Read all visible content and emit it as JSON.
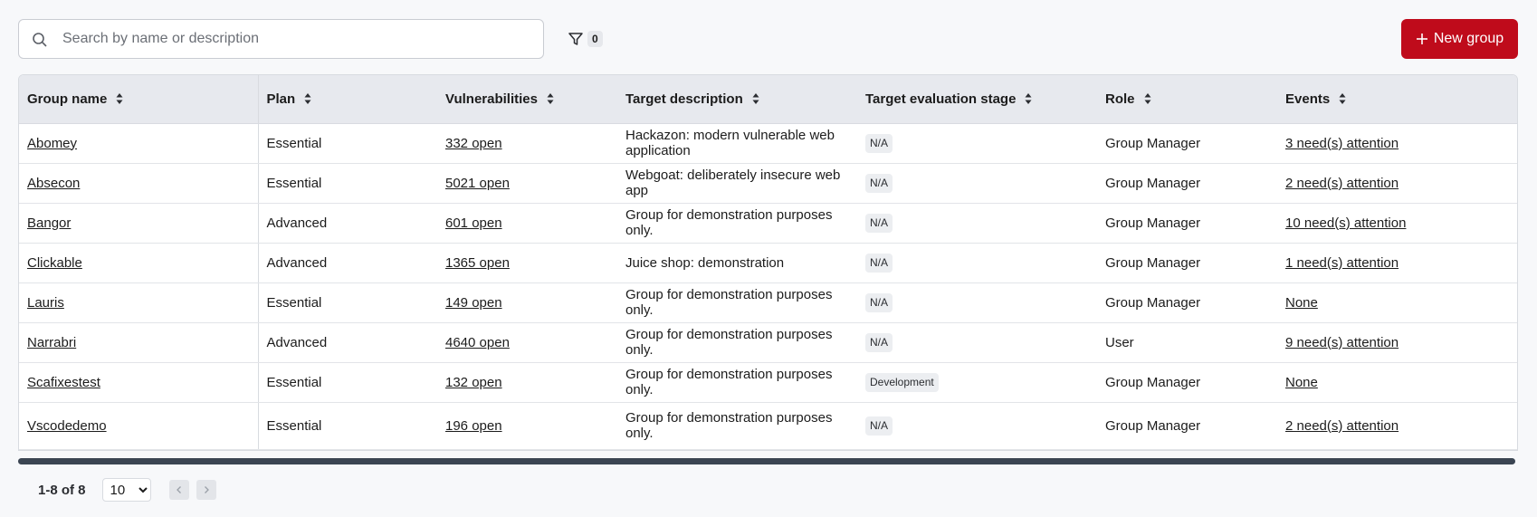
{
  "search": {
    "placeholder": "Search by name or description",
    "value": ""
  },
  "filter": {
    "count": "0",
    "icon": "filter-icon"
  },
  "new_group_button": {
    "label": "New group",
    "color": "#bf0b1b",
    "icon": "plus-icon"
  },
  "table": {
    "columns": [
      {
        "label": "Group name"
      },
      {
        "label": "Plan"
      },
      {
        "label": "Vulnerabilities"
      },
      {
        "label": "Target description"
      },
      {
        "label": "Target evaluation stage"
      },
      {
        "label": "Role"
      },
      {
        "label": "Events"
      }
    ],
    "rows": [
      {
        "name": "Abomey",
        "plan": "Essential",
        "vulnerabilities": "332 open",
        "description": "Hackazon: modern vulnerable web application",
        "stage": "N/A",
        "role": "Group Manager",
        "events": "3 need(s) attention"
      },
      {
        "name": "Absecon",
        "plan": "Essential",
        "vulnerabilities": "5021 open",
        "description": "Webgoat: deliberately insecure web app",
        "stage": "N/A",
        "role": "Group Manager",
        "events": "2 need(s) attention"
      },
      {
        "name": "Bangor",
        "plan": "Advanced",
        "vulnerabilities": "601 open",
        "description": "Group for demonstration purposes only.",
        "stage": "N/A",
        "role": "Group Manager",
        "events": "10 need(s) attention"
      },
      {
        "name": "Clickable",
        "plan": "Advanced",
        "vulnerabilities": "1365 open",
        "description": "Juice shop: demonstration",
        "stage": "N/A",
        "role": "Group Manager",
        "events": "1 need(s) attention"
      },
      {
        "name": "Lauris",
        "plan": "Essential",
        "vulnerabilities": "149 open",
        "description": "Group for demonstration purposes only.",
        "stage": "N/A",
        "role": "Group Manager",
        "events": "None"
      },
      {
        "name": "Narrabri",
        "plan": "Advanced",
        "vulnerabilities": "4640 open",
        "description": "Group for demonstration purposes only.",
        "stage": "N/A",
        "role": "User",
        "events": "9 need(s) attention"
      },
      {
        "name": "Scafixestest",
        "plan": "Essential",
        "vulnerabilities": "132 open",
        "description": "Group for demonstration purposes only.",
        "stage": "Development",
        "role": "Group Manager",
        "events": "None"
      },
      {
        "name": "Vscodedemo",
        "plan": "Essential",
        "vulnerabilities": "196 open",
        "description": "Group for demonstration purposes only.",
        "stage": "N/A",
        "role": "Group Manager",
        "events": "2 need(s) attention"
      }
    ]
  },
  "pagination": {
    "range": "1-8 of 8",
    "page_size": "10",
    "page_size_options": [
      "10"
    ],
    "prev_icon": "chevron-left-icon",
    "next_icon": "chevron-right-icon"
  }
}
